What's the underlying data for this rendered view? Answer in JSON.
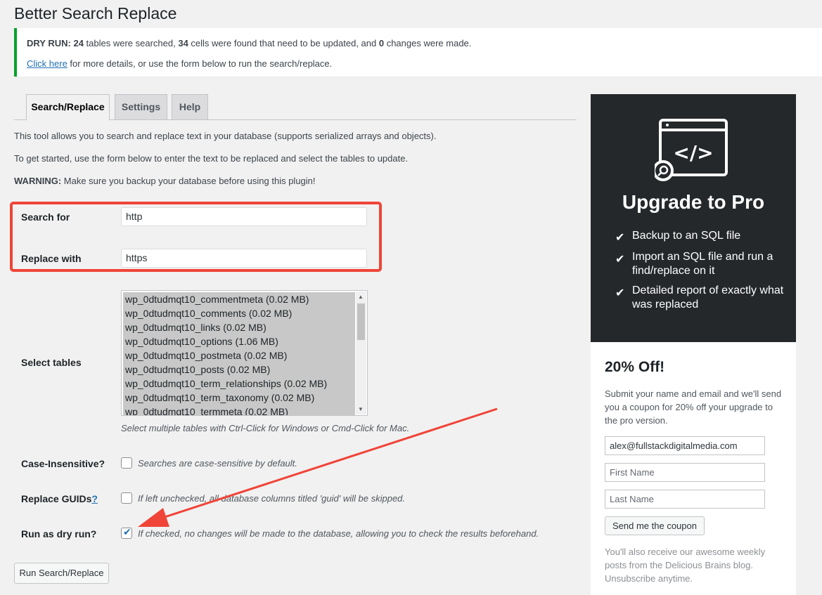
{
  "page_title": "Better Search Replace",
  "notice": {
    "dry_run_label": "DRY RUN:",
    "tables_count": "24",
    "text_a": " tables were searched, ",
    "cells_count": "34",
    "text_b": " cells were found that need to be updated, and ",
    "changes_count": "0",
    "text_c": " changes were made.",
    "link_text": "Click here",
    "line2_rest": " for more details, or use the form below to run the search/replace."
  },
  "tabs": [
    {
      "label": "Search/Replace",
      "active": true
    },
    {
      "label": "Settings",
      "active": false
    },
    {
      "label": "Help",
      "active": false
    }
  ],
  "intro": {
    "p1": "This tool allows you to search and replace text in your database (supports serialized arrays and objects).",
    "p2": "To get started, use the form below to enter the text to be replaced and select the tables to update.",
    "warning_label": "WARNING:",
    "warning_text": " Make sure you backup your database before using this plugin!"
  },
  "form": {
    "search_label": "Search for",
    "search_value": "http",
    "replace_label": "Replace with",
    "replace_value": "https",
    "tables_label": "Select tables",
    "tables": [
      "wp_0dtudmqt10_commentmeta (0.02 MB)",
      "wp_0dtudmqt10_comments (0.02 MB)",
      "wp_0dtudmqt10_links (0.02 MB)",
      "wp_0dtudmqt10_options (1.06 MB)",
      "wp_0dtudmqt10_postmeta (0.02 MB)",
      "wp_0dtudmqt10_posts (0.02 MB)",
      "wp_0dtudmqt10_term_relationships (0.02 MB)",
      "wp_0dtudmqt10_term_taxonomy (0.02 MB)",
      "wp_0dtudmqt10_termmeta (0.02 MB)"
    ],
    "tables_hint": "Select multiple tables with Ctrl-Click for Windows or Cmd-Click for Mac.",
    "case_label": "Case-Insensitive?",
    "case_desc": "Searches are case-sensitive by default.",
    "case_checked": false,
    "guids_label": "Replace GUIDs",
    "guids_link": "?",
    "guids_desc": "If left unchecked, all database columns titled 'guid' will be skipped.",
    "guids_checked": false,
    "dry_label": "Run as dry run?",
    "dry_desc": "If checked, no changes will be made to the database, allowing you to check the results beforehand.",
    "dry_checked": true,
    "submit_label": "Run Search/Replace"
  },
  "sidebar": {
    "pro_title": "Upgrade to Pro",
    "features": [
      "Backup to an SQL file",
      "Import an SQL file and run a find/replace on it",
      "Detailed report of exactly what was replaced"
    ],
    "coupon_title": "20% Off!",
    "coupon_desc": "Submit your name and email and we'll send you a coupon for 20% off your upgrade to the pro version.",
    "email_value": "alex@fullstackdigitalmedia.com",
    "first_name_placeholder": "First Name",
    "last_name_placeholder": "Last Name",
    "coupon_button": "Send me the coupon",
    "coupon_footer": "You'll also receive our awesome weekly posts from the Delicious Brains blog. Unsubscribe anytime."
  },
  "colors": {
    "success_border": "#00a32a",
    "highlight_red": "#f04438",
    "pro_bg": "#25282b",
    "link": "#2271b1"
  }
}
